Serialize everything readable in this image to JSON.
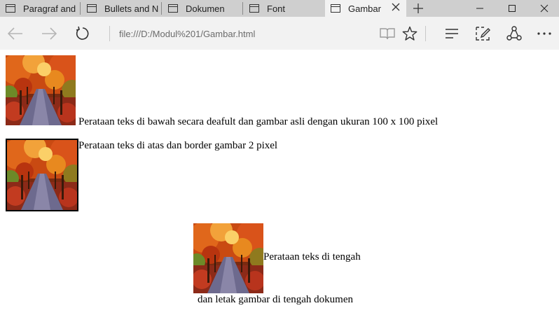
{
  "tabs": [
    {
      "label": "Paragraf and"
    },
    {
      "label": "Bullets and N"
    },
    {
      "label": "Dokumen"
    },
    {
      "label": "Font"
    },
    {
      "label": "Gambar"
    }
  ],
  "address": {
    "url": "file:///D:/Modul%201/Gambar.html"
  },
  "page": {
    "line1": "Perataan teks di bawah secara deafult dan gambar asli dengan ukuran 100 x 100 pixel",
    "line2": "Perataan teks di atas dan border gambar 2 pixel",
    "line3": "Perataan teks di tengah",
    "line4": "dan letak gambar di tengah dokumen"
  }
}
